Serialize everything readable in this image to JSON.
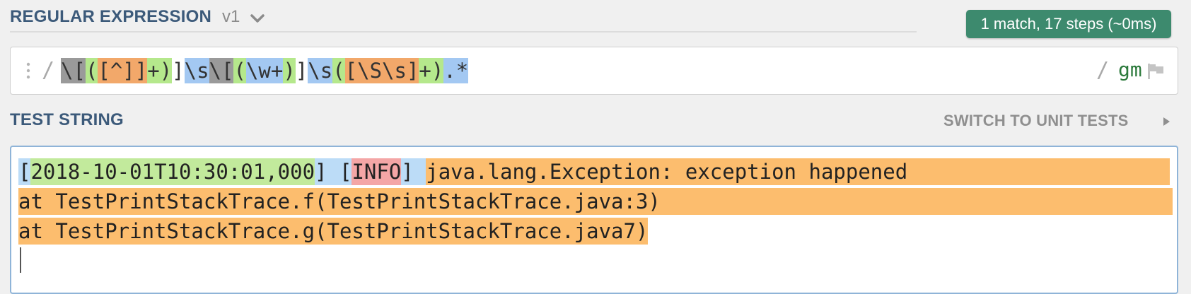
{
  "regex_section": {
    "title": "REGULAR EXPRESSION",
    "version": "v1",
    "match_info": "1 match, 17 steps (~0ms)",
    "delimiter_open": "/",
    "delimiter_close": "/",
    "flags": "gm",
    "pattern_tokens": [
      {
        "text": "\\[",
        "group": "gray"
      },
      {
        "text": "(",
        "group": "green"
      },
      {
        "text": "[^]]",
        "group": "orange"
      },
      {
        "text": "+)",
        "group": "green"
      },
      {
        "text": "]",
        "group": "none"
      },
      {
        "text": "\\s",
        "group": "blue"
      },
      {
        "text": "\\[",
        "group": "gray"
      },
      {
        "text": "(",
        "group": "green"
      },
      {
        "text": "\\w+",
        "group": "blue"
      },
      {
        "text": ")",
        "group": "green"
      },
      {
        "text": "]",
        "group": "none"
      },
      {
        "text": "\\s",
        "group": "blue"
      },
      {
        "text": "(",
        "group": "green"
      },
      {
        "text": "[\\S\\s]",
        "group": "orange"
      },
      {
        "text": "+)",
        "group": "green"
      },
      {
        "text": ".*",
        "group": "blue"
      }
    ]
  },
  "test_section": {
    "title": "TEST STRING",
    "switch_label": "SWITCH TO UNIT TESTS",
    "line1": {
      "open_bracket": "[",
      "timestamp": "2018-10-01T10:30:01,000",
      "close_bracket": "]",
      "space1": " ",
      "level_open": "[",
      "level": "INFO",
      "level_close": "]",
      "space2": " ",
      "message": "java.lang.Exception: exception happened"
    },
    "line2": "at TestPrintStackTrace.f(TestPrintStackTrace.java:3)",
    "line3": "at TestPrintStackTrace.g(TestPrintStackTrace.java7)"
  },
  "colors": {
    "title": "#3c5a7a",
    "match_badge": "#3d8a6e",
    "highlight_green": "#b5e88c",
    "highlight_orange": "#f2a86a",
    "highlight_blue": "#a3c8f2",
    "highlight_gray": "#9a9a9a",
    "match_orange": "#fcbd6e",
    "level_red": "#f4a6a6"
  },
  "icons": {
    "version_dropdown": "chevron-down-icon",
    "drag_handle": "drag-handle-icon",
    "flag": "flag-icon",
    "switch_arrow": "triangle-right-icon"
  }
}
